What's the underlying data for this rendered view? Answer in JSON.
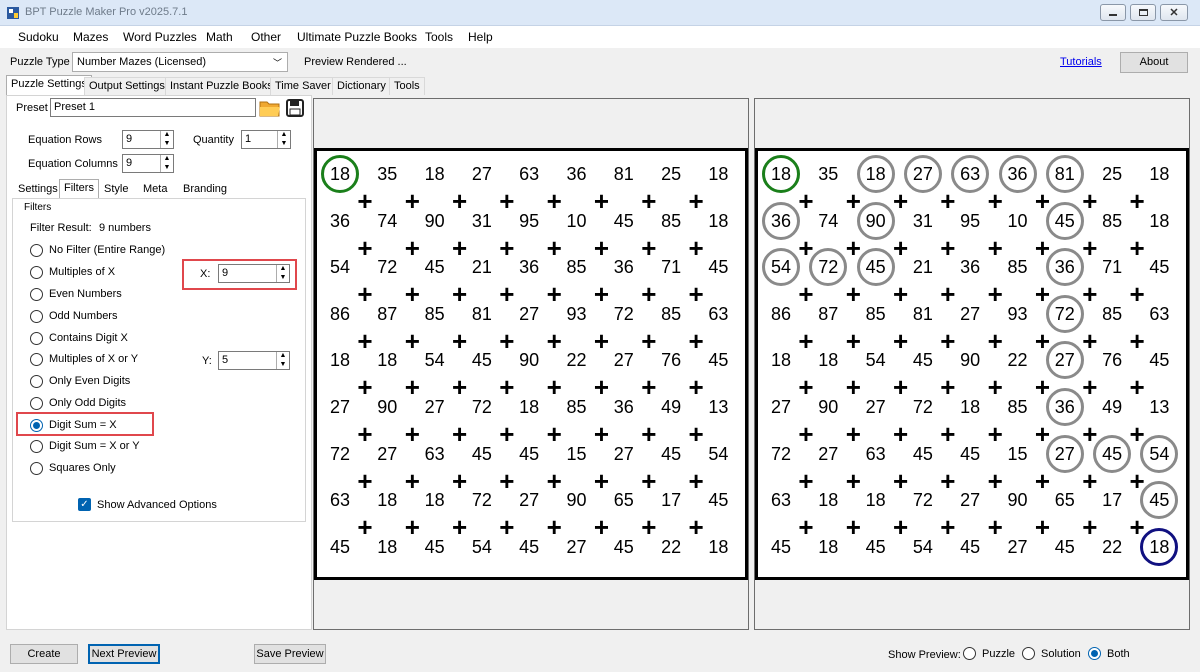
{
  "window": {
    "title": "BPT Puzzle Maker Pro v2025.7.1"
  },
  "menu": [
    "Sudoku",
    "Mazes",
    "Word Puzzles",
    "Math",
    "Other",
    "Ultimate Puzzle Books",
    "Tools",
    "Help"
  ],
  "toolbar": {
    "puzzle_type_label": "Puzzle Type",
    "puzzle_type_value": "Number Mazes (Licensed)",
    "status": "Preview Rendered ...",
    "tutorials_link": "Tutorials",
    "about_button": "About"
  },
  "main_tabs": [
    "Puzzle Settings",
    "Output Settings",
    "Instant Puzzle Books",
    "Time Saver",
    "Dictionary",
    "Tools"
  ],
  "preset": {
    "label": "Preset",
    "value": "Preset 1"
  },
  "equation": {
    "rows_label": "Equation Rows",
    "rows_value": "9",
    "columns_label": "Equation Columns",
    "columns_value": "9",
    "quantity_label": "Quantity",
    "quantity_value": "1"
  },
  "sub_tabs": [
    "Settings",
    "Filters",
    "Style",
    "Meta",
    "Branding"
  ],
  "filters": {
    "group_label": "Filters",
    "result_label": "Filter Result:",
    "result_value": "9 numbers",
    "x_label": "X:",
    "x_value": "9",
    "y_label": "Y:",
    "y_value": "5",
    "options": [
      "No Filter (Entire Range)",
      "Multiples of X",
      "Even Numbers",
      "Odd Numbers",
      "Contains Digit X",
      "Multiples of X or Y",
      "Only Even Digits",
      "Only Odd Digits",
      "Digit Sum = X",
      "Digit Sum = X or Y",
      "Squares Only"
    ],
    "selected_index": 8,
    "advanced_label": "Show Advanced Options"
  },
  "grid": [
    [
      "18",
      "35",
      "18",
      "27",
      "63",
      "36",
      "81",
      "25",
      "18"
    ],
    [
      "36",
      "74",
      "90",
      "31",
      "95",
      "10",
      "45",
      "85",
      "18"
    ],
    [
      "54",
      "72",
      "45",
      "21",
      "36",
      "85",
      "36",
      "71",
      "45"
    ],
    [
      "86",
      "87",
      "85",
      "81",
      "27",
      "93",
      "72",
      "85",
      "63"
    ],
    [
      "18",
      "18",
      "54",
      "45",
      "90",
      "22",
      "27",
      "76",
      "45"
    ],
    [
      "27",
      "90",
      "27",
      "72",
      "18",
      "85",
      "36",
      "49",
      "13"
    ],
    [
      "72",
      "27",
      "63",
      "45",
      "45",
      "15",
      "27",
      "45",
      "54"
    ],
    [
      "63",
      "18",
      "18",
      "72",
      "27",
      "90",
      "65",
      "17",
      "45"
    ],
    [
      "45",
      "18",
      "45",
      "54",
      "45",
      "27",
      "45",
      "22",
      "18"
    ]
  ],
  "operator_symbol": "+",
  "solution_path": [
    [
      0,
      0
    ],
    [
      0,
      2
    ],
    [
      0,
      3
    ],
    [
      0,
      4
    ],
    [
      0,
      5
    ],
    [
      0,
      6
    ],
    [
      1,
      0
    ],
    [
      1,
      2
    ],
    [
      1,
      6
    ],
    [
      2,
      0
    ],
    [
      2,
      1
    ],
    [
      2,
      2
    ],
    [
      2,
      6
    ],
    [
      3,
      6
    ],
    [
      4,
      6
    ],
    [
      5,
      6
    ],
    [
      6,
      6
    ],
    [
      6,
      7
    ],
    [
      6,
      8
    ],
    [
      7,
      8
    ],
    [
      8,
      8
    ]
  ],
  "colors": {
    "start": "#1a7f1a",
    "end": "#101080",
    "path": "#8a8a8a",
    "highlight_box": "#e0474c",
    "accent": "#0063b1"
  },
  "bottom": {
    "create_button": "Create",
    "next_preview_button": "Next Preview",
    "save_preview_button": "Save Preview",
    "show_preview_label": "Show Preview:",
    "preview_options": [
      "Puzzle",
      "Solution",
      "Both"
    ],
    "preview_selected": 2
  }
}
